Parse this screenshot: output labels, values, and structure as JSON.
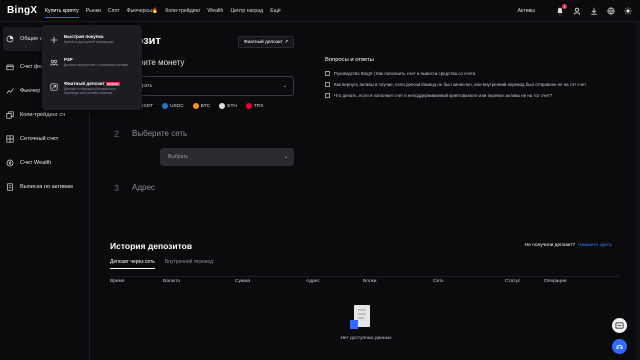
{
  "app": {
    "logo": "BingX"
  },
  "topnav": {
    "items": [
      {
        "label": "Купить криптy"
      },
      {
        "label": "Рынки"
      },
      {
        "label": "Спот"
      },
      {
        "label": "Фьючерсы🔥"
      },
      {
        "label": "Копи-трейдинг"
      },
      {
        "label": "Wealth"
      },
      {
        "label": "Центр наград"
      },
      {
        "label": "Ещё"
      }
    ],
    "assets_label": "Активы",
    "notification_count": "1"
  },
  "dropdown": {
    "items": [
      {
        "title": "Быстрая покупка",
        "desc": "Купить в доступной транзакции",
        "icon": "plus-icon"
      },
      {
        "title": "P2P",
        "desc": "Десятки мерчантов с оплатными ценами",
        "icon": "p2p-icon"
      },
      {
        "title": "Фиатный депозит",
        "tag": "НОВОЕ",
        "desc": "Депозит с помощью безопасного перевода или онлайн-платежа",
        "icon": "fiat-icon"
      }
    ]
  },
  "sidebar": {
    "items": [
      {
        "label": "Общие с",
        "icon": "overview-icon"
      },
      {
        "label": "Счет фо",
        "icon": "fund-icon"
      },
      {
        "label": "Фьючер",
        "icon": "futures-icon"
      },
      {
        "label": "Копи-трейдинг сч",
        "icon": "copy-icon"
      },
      {
        "label": "Сеточный счет",
        "icon": "grid-icon"
      },
      {
        "label": "Счет Wealth",
        "icon": "wealth-icon"
      },
      {
        "label": "Выписка по активам",
        "icon": "statement-icon"
      }
    ]
  },
  "main": {
    "title": "позит",
    "fiat_button": "Фиатный депозит ↗",
    "step1": {
      "num": "",
      "title": "берите монету",
      "placeholder": "брать"
    },
    "coins": [
      {
        "name": "USDT",
        "color": "#26a17b"
      },
      {
        "name": "USDC",
        "color": "#2775ca"
      },
      {
        "name": "BTC",
        "color": "#f7931a"
      },
      {
        "name": "ETH",
        "color": "#e0e0e0"
      },
      {
        "name": "TRX",
        "color": "#ef0027"
      }
    ],
    "step2": {
      "num": "2",
      "title": "Выберите сеть",
      "placeholder": "Выбрать"
    },
    "step3": {
      "num": "3",
      "title": "Адрес"
    }
  },
  "faq": {
    "title": "Вопросы и ответы",
    "items": [
      "Руководство BingX | Как пополнить счет и вывести средства со счета",
      "Как вернуть активы в случае, если депозит/вывод не был зачислен, или внутренний перевод был отправлен не на тот счет",
      "Что делать, если я пополнил счет и неподдерживаемой криптовалюте или перевел активы не на тот счет?"
    ]
  },
  "history": {
    "title": "История депозитов",
    "not_received": "Не получили депозит?",
    "not_received_link": "Нажмите здесь",
    "tabs": [
      "Депозит через сеть",
      "Внутренний перевод"
    ],
    "columns": [
      "Время",
      "Валюта",
      "Сумма",
      "Адрес",
      "Блоки",
      "Сеть",
      "Статус",
      "Операции"
    ],
    "empty_text": "Нет доступных данных"
  }
}
